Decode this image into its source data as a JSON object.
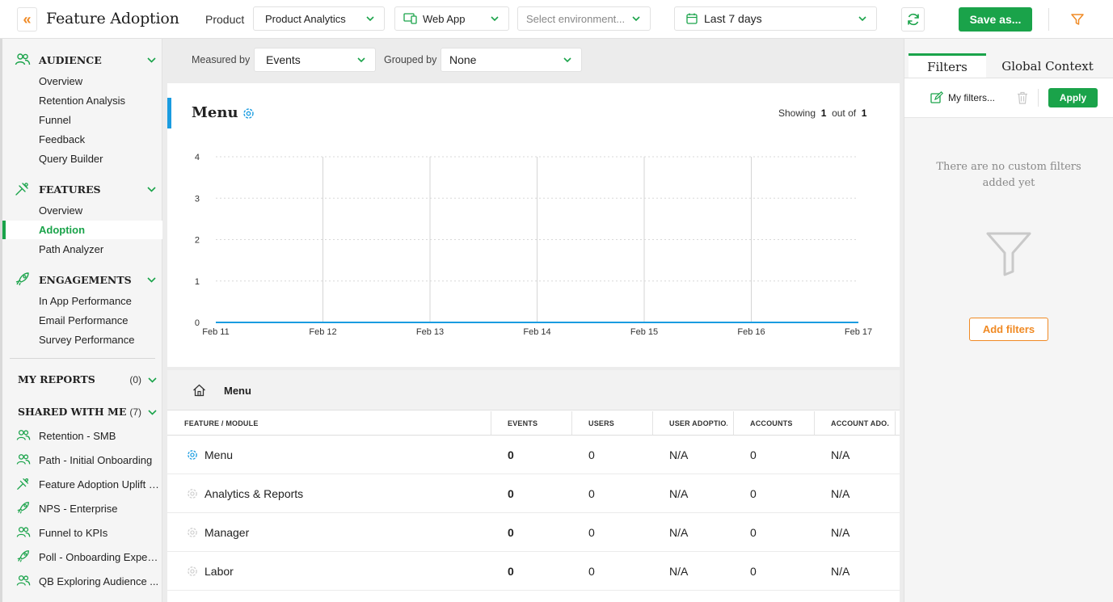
{
  "header": {
    "title": "Feature Adoption",
    "product_label": "Product",
    "product_value": "Product Analytics",
    "app_value": "Web App",
    "environment_placeholder": "Select environment...",
    "date_range": "Last 7 days",
    "save_label": "Save as..."
  },
  "sidebar": {
    "audience": {
      "title": "AUDIENCE",
      "items": [
        "Overview",
        "Retention Analysis",
        "Funnel",
        "Feedback",
        "Query Builder"
      ]
    },
    "features": {
      "title": "FEATURES",
      "items": [
        "Overview",
        "Adoption",
        "Path Analyzer"
      ],
      "active": "Adoption"
    },
    "engagements": {
      "title": "ENGAGEMENTS",
      "items": [
        "In App Performance",
        "Email Performance",
        "Survey Performance"
      ]
    },
    "my_reports": {
      "title": "MY REPORTS",
      "count": "(0)"
    },
    "shared_with_me": {
      "title": "SHARED WITH ME",
      "count": "(7)",
      "items": [
        {
          "label": "Retention - SMB",
          "icon": "audience-icon"
        },
        {
          "label": "Path - Initial Onboarding",
          "icon": "audience-icon"
        },
        {
          "label": "Feature Adoption Uplift -...",
          "icon": "features-icon"
        },
        {
          "label": "NPS - Enterprise",
          "icon": "engagements-icon"
        },
        {
          "label": "Funnel to KPIs",
          "icon": "audience-icon"
        },
        {
          "label": "Poll - Onboarding Experi...",
          "icon": "engagements-icon"
        },
        {
          "label": "QB Exploring Audience ...",
          "icon": "audience-icon"
        }
      ]
    }
  },
  "toolbar": {
    "measured_by_label": "Measured by",
    "measured_by_value": "Events",
    "grouped_by_label": "Grouped by",
    "grouped_by_value": "None"
  },
  "chart_card": {
    "title": "Menu",
    "showing_prefix": "Showing",
    "showing_current": "1",
    "showing_mid": "out of",
    "showing_total": "1"
  },
  "chart_data": {
    "type": "line",
    "categories": [
      "Feb 11",
      "Feb 12",
      "Feb 13",
      "Feb 14",
      "Feb 15",
      "Feb 16",
      "Feb 17"
    ],
    "series": [
      {
        "values": [
          0,
          0,
          0,
          0,
          0,
          0,
          0
        ]
      }
    ],
    "yticks": [
      0,
      1,
      2,
      3,
      4
    ],
    "ylim": [
      0,
      4
    ],
    "grid": true,
    "line_color": "#1a9ce0"
  },
  "table": {
    "breadcrumb": "Menu",
    "columns": [
      "FEATURE / MODULE",
      "EVENTS",
      "USERS",
      "USER ADOPTIO...",
      "ACCOUNTS",
      "ACCOUNT ADO..."
    ],
    "rows": [
      {
        "name": "Menu",
        "events": "0",
        "users": "0",
        "user_adoption": "N/A",
        "accounts": "0",
        "account_adoption": "N/A"
      },
      {
        "name": "Analytics & Reports",
        "events": "0",
        "users": "0",
        "user_adoption": "N/A",
        "accounts": "0",
        "account_adoption": "N/A"
      },
      {
        "name": "Manager",
        "events": "0",
        "users": "0",
        "user_adoption": "N/A",
        "accounts": "0",
        "account_adoption": "N/A"
      },
      {
        "name": "Labor",
        "events": "0",
        "users": "0",
        "user_adoption": "N/A",
        "accounts": "0",
        "account_adoption": "N/A"
      }
    ]
  },
  "right_panel": {
    "tabs": [
      "Filters",
      "Global Context"
    ],
    "my_filters": "My filters...",
    "apply_label": "Apply",
    "empty_text": "There are no custom filters added yet",
    "add_filters_label": "Add filters"
  },
  "colors": {
    "brand_green": "#1aa34a",
    "accent_orange": "#f08a24",
    "chart_blue": "#1a9ce0"
  }
}
